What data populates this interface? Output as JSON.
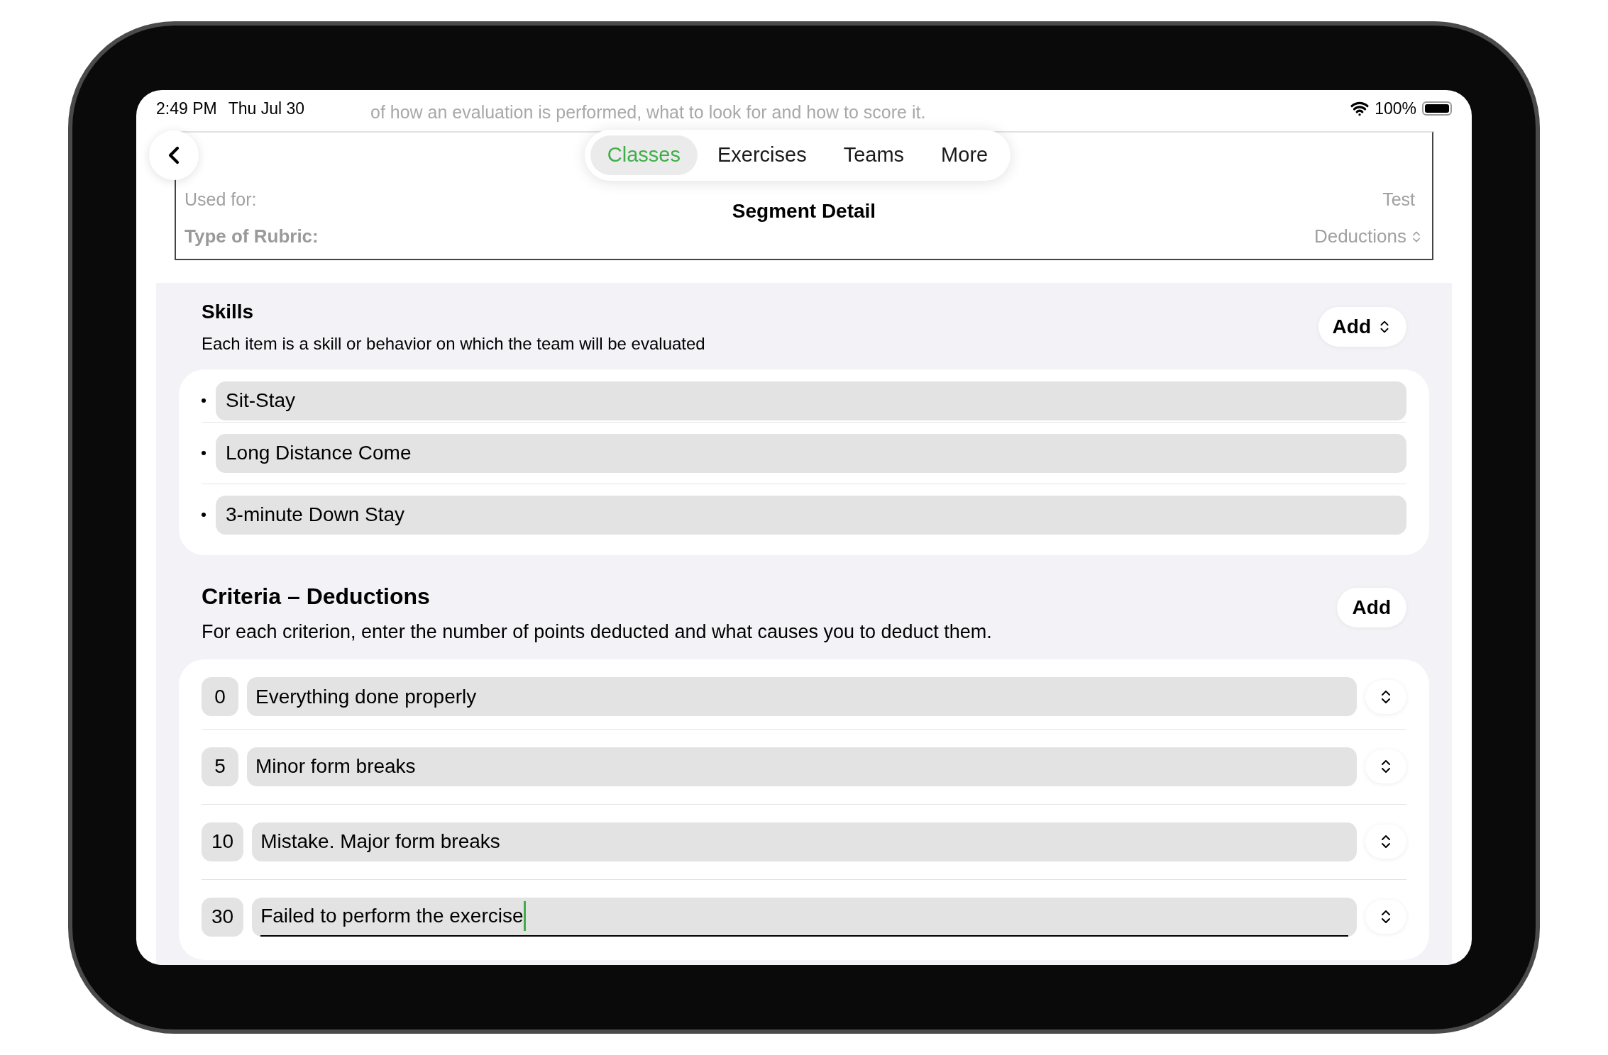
{
  "status_bar": {
    "time": "2:49 PM",
    "date": "Thu Jul 30",
    "battery": "100%"
  },
  "background_form": {
    "description": "of how an evaluation is performed, what to look for and how to score it.",
    "used_for_label": "Used for:",
    "used_for_value": "Test",
    "rubric_label": "Type of Rubric:",
    "rubric_value": "Deductions"
  },
  "tabs": [
    {
      "label": "Classes",
      "selected": true
    },
    {
      "label": "Exercises",
      "selected": false
    },
    {
      "label": "Teams",
      "selected": false
    },
    {
      "label": "More",
      "selected": false
    }
  ],
  "title": "Segment Detail",
  "skills": {
    "title": "Skills",
    "subtitle": "Each item is a skill or behavior on which the team will be evaluated",
    "add_button": "Add",
    "items": [
      "Sit-Stay",
      "Long Distance Come",
      "3-minute Down Stay"
    ]
  },
  "criteria": {
    "title": "Criteria – Deductions",
    "subtitle": "For each criterion, enter the number of points deducted and what causes you to deduct them.",
    "add_button": "Add",
    "items": [
      {
        "points": "0",
        "text": "Everything done properly",
        "focused": false
      },
      {
        "points": "5",
        "text": "Minor form breaks",
        "focused": false
      },
      {
        "points": "10",
        "text": "Mistake. Major form breaks",
        "focused": false
      },
      {
        "points": "30",
        "text": "Failed to perform the exercise",
        "focused": true
      }
    ]
  }
}
